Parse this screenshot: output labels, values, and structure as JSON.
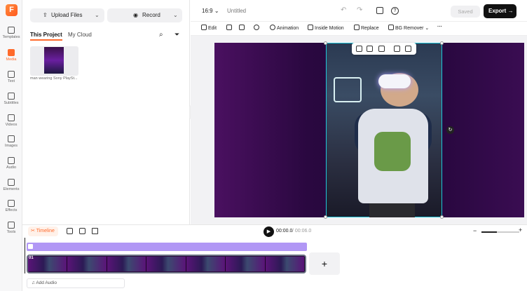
{
  "app": {
    "logo_letter": "F",
    "project_title": "Untitled",
    "aspect": "16:9"
  },
  "rail": {
    "items": [
      {
        "label": "Templates"
      },
      {
        "label": "Media",
        "active": true
      },
      {
        "label": "Text"
      },
      {
        "label": "Subtitles"
      },
      {
        "label": "Videos"
      },
      {
        "label": "Images"
      },
      {
        "label": "Audio"
      },
      {
        "label": "Elements"
      },
      {
        "label": "Effects"
      },
      {
        "label": "Tools"
      }
    ]
  },
  "media": {
    "upload_label": "Upload Files",
    "record_label": "Record",
    "tab_project": "This Project",
    "tab_cloud": "My Cloud",
    "item_caption": "man wearing Sony PlaySt..."
  },
  "top": {
    "saved_label": "Saved",
    "export_label": "Export"
  },
  "toolbar": {
    "edit": "Edit",
    "animation": "Animation",
    "inside_motion": "Inside Motion",
    "replace": "Replace",
    "bg_remover": "BG Remover"
  },
  "timeline": {
    "label": "Timeline",
    "time_current": "00:00.0",
    "time_total": "/ 00:06.0",
    "clip_index": "01",
    "add_audio": "Add Audio",
    "zoom_level": 0.4
  },
  "colors": {
    "accent": "#ff6a2b",
    "selection": "#20c5d9",
    "audio_track": "#b197f5"
  }
}
